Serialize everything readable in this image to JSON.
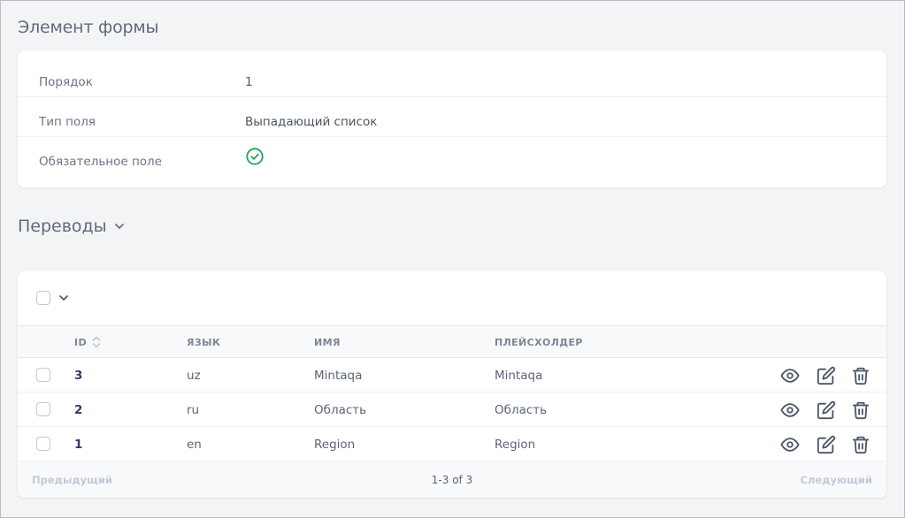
{
  "page_title": "Элемент формы",
  "details": [
    {
      "label": "Порядок",
      "value": "1"
    },
    {
      "label": "Тип поля",
      "value": "Выпадающий список"
    },
    {
      "label": "Обязательное поле",
      "value": ""
    }
  ],
  "required_icon": "check-circle-icon",
  "translations": {
    "title": "Переводы",
    "columns": {
      "id": "ID",
      "lang": "ЯЗЫК",
      "name": "ИМЯ",
      "placeholder": "ПЛЕЙСХОЛДЕР"
    },
    "rows": [
      {
        "id": "3",
        "lang": "uz",
        "name": "Mintaqa",
        "placeholder": "Mintaqa"
      },
      {
        "id": "2",
        "lang": "ru",
        "name": "Область",
        "placeholder": "Область"
      },
      {
        "id": "1",
        "lang": "en",
        "name": "Region",
        "placeholder": "Region"
      }
    ],
    "pager": {
      "prev": "Предыдущий",
      "info": "1-3 of 3",
      "next": "Следующий"
    }
  },
  "colors": {
    "check": "#22a55a",
    "accent": "#2b3a67",
    "icon": "#4a5568"
  }
}
